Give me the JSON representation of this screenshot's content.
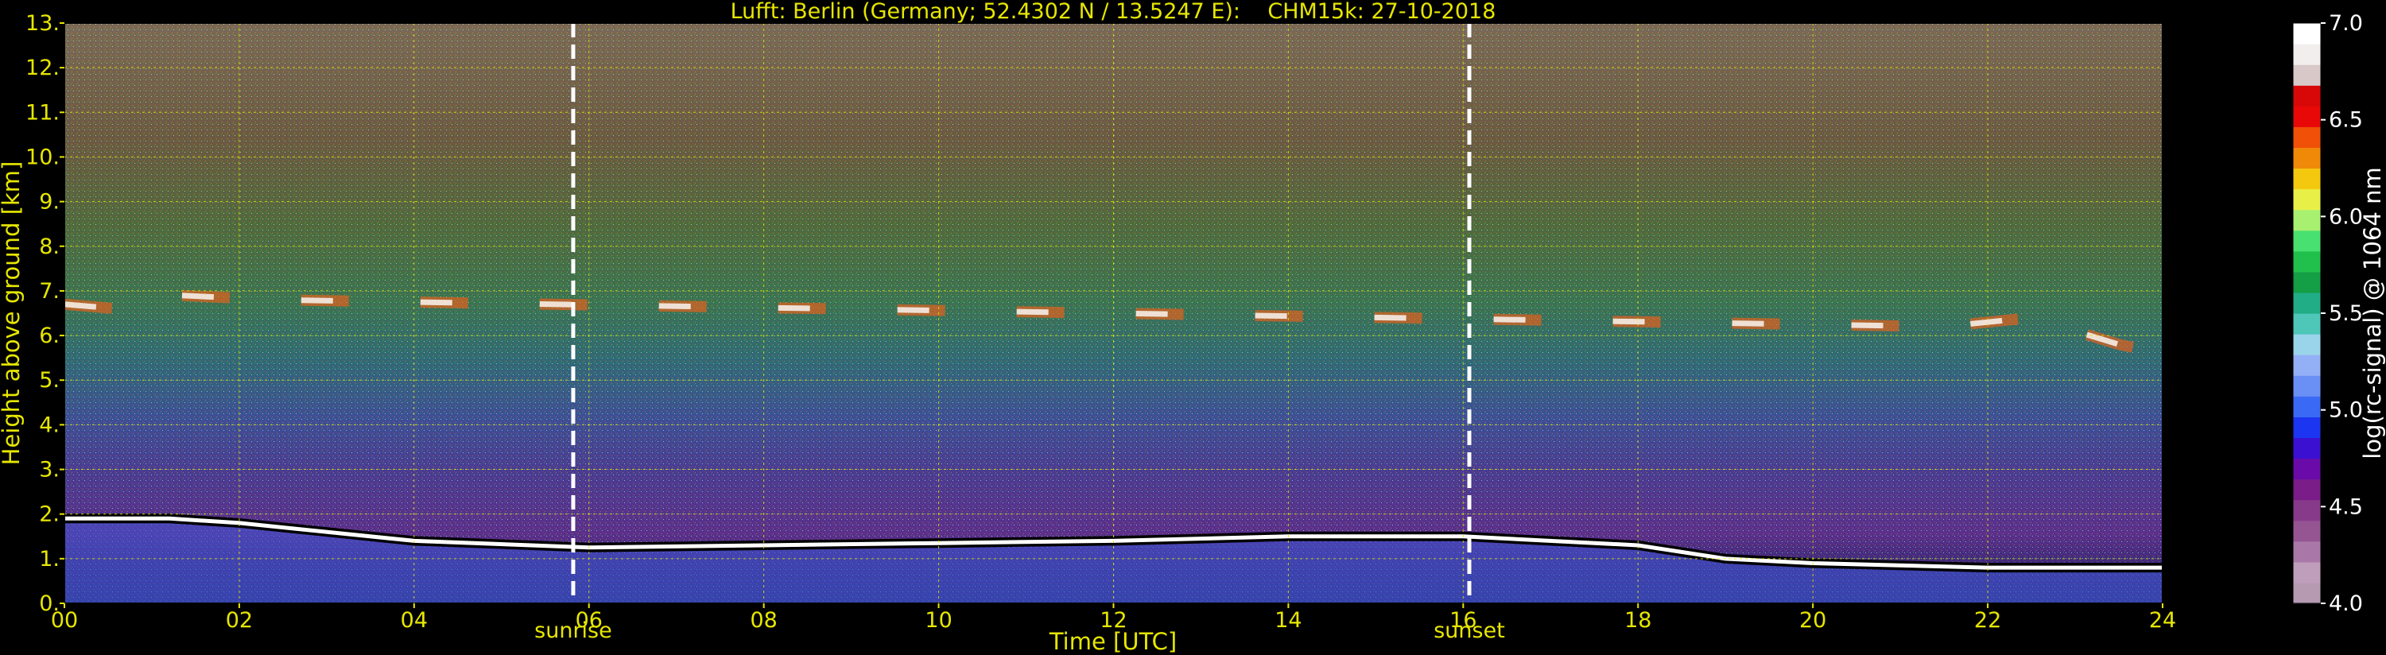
{
  "chart_data": {
    "type": "heatmap",
    "title": "Lufft: Berlin (Germany; 52.4302 N / 13.5247 E):    CHM15k: 27-10-2018",
    "xlabel": "Time [UTC]",
    "ylabel": "Height above ground [km]",
    "xlim": [
      0,
      24
    ],
    "ylim": [
      0,
      13
    ],
    "x_ticks": [
      0,
      2,
      4,
      6,
      8,
      10,
      12,
      14,
      16,
      18,
      20,
      22,
      24
    ],
    "x_tick_labels": [
      "00",
      "02",
      "04",
      "06",
      "08",
      "10",
      "12",
      "14",
      "16",
      "18",
      "20",
      "22",
      "24"
    ],
    "y_ticks": [
      0,
      1,
      2,
      3,
      4,
      5,
      6,
      7,
      8,
      9,
      10,
      11,
      12,
      13
    ],
    "y_tick_labels": [
      "0.",
      "1.",
      "2.",
      "3.",
      "4.",
      "5.",
      "6.",
      "7.",
      "8.",
      "9.",
      "10.",
      "11.",
      "12.",
      "13."
    ],
    "grid": true,
    "grid_color": "#e6e600",
    "colorbar": {
      "label": "log(rc-signal) @ 1064 nm",
      "range": [
        4.0,
        7.0
      ],
      "ticks": [
        4.0,
        4.5,
        5.0,
        5.5,
        6.0,
        6.5,
        7.0
      ],
      "tick_labels": [
        "4.0",
        "4.5",
        "5.0",
        "5.5",
        "6.0",
        "6.5",
        "7.0"
      ],
      "colors": [
        "#b59ab2",
        "#bf9ebc",
        "#a978a8",
        "#955593",
        "#883a8a",
        "#7a1d88",
        "#6a0aa8",
        "#3b10d0",
        "#1c35f0",
        "#3a6af5",
        "#6a8ff5",
        "#93aff5",
        "#9ad4ea",
        "#4ec6b8",
        "#21ad86",
        "#149e45",
        "#21c04c",
        "#48e070",
        "#a8f070",
        "#e8f048",
        "#f5c810",
        "#f08808",
        "#f05008",
        "#e80808",
        "#d80808",
        "#d8c8c8",
        "#f2eeee",
        "#ffffff"
      ]
    },
    "markers": [
      {
        "x": 5.82,
        "label": "sunrise"
      },
      {
        "x": 16.07,
        "label": "sunset"
      }
    ],
    "features": [
      {
        "name": "boundary layer top",
        "x": [
          0,
          1.2,
          2.0,
          4.0,
          6.0,
          8.0,
          10.0,
          12.0,
          14.0,
          16.0,
          18.0,
          19.0,
          20.0,
          22.0,
          24.0
        ],
        "y": [
          1.9,
          1.9,
          1.8,
          1.4,
          1.25,
          1.3,
          1.35,
          1.4,
          1.5,
          1.5,
          1.3,
          1.0,
          0.9,
          0.8,
          0.8
        ]
      },
      {
        "name": "mid-level cloud",
        "x": [
          0,
          0.6,
          1.3,
          2.4,
          21.5,
          22.5,
          23.5,
          24
        ],
        "y": [
          6.7,
          6.6,
          6.9,
          6.8,
          6.2,
          6.4,
          5.8,
          5.6
        ]
      }
    ]
  }
}
